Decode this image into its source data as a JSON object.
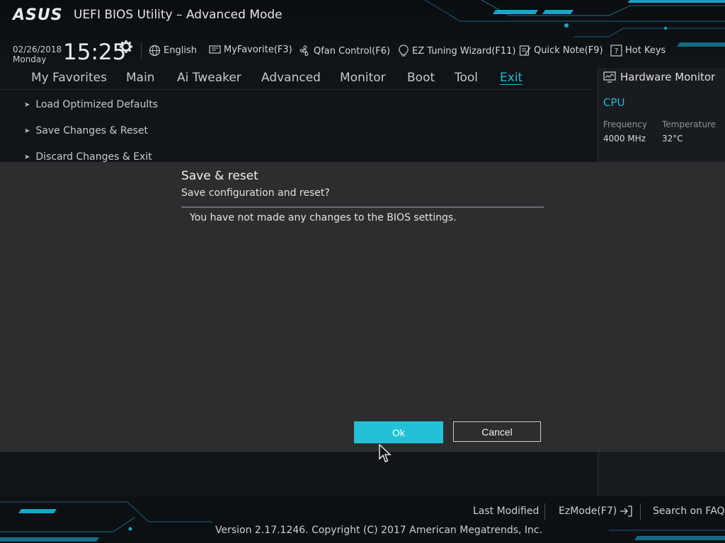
{
  "header": {
    "logo_text": "ASUS",
    "title": "UEFI BIOS Utility – Advanced Mode",
    "date": "02/26/2018",
    "weekday": "Monday",
    "time": "15:25",
    "toolbar": [
      {
        "label": "English",
        "icon": "globe-icon"
      },
      {
        "label": "MyFavorite(F3)",
        "icon": "monitor-icon"
      },
      {
        "label": "Qfan Control(F6)",
        "icon": "fan-icon"
      },
      {
        "label": "EZ Tuning Wizard(F11)",
        "icon": "lightbulb-icon"
      },
      {
        "label": "Quick Note(F9)",
        "icon": "note-icon"
      },
      {
        "label": "Hot Keys",
        "icon": "question-icon"
      }
    ]
  },
  "nav": {
    "tabs": [
      {
        "label": "My Favorites"
      },
      {
        "label": "Main"
      },
      {
        "label": "Ai Tweaker"
      },
      {
        "label": "Advanced"
      },
      {
        "label": "Monitor"
      },
      {
        "label": "Boot"
      },
      {
        "label": "Tool"
      },
      {
        "label": "Exit",
        "active": true
      }
    ]
  },
  "main": {
    "items": [
      {
        "label": "Load Optimized Defaults"
      },
      {
        "label": "Save Changes & Reset"
      },
      {
        "label": "Discard Changes & Exit"
      }
    ]
  },
  "hardware_monitor": {
    "title": "Hardware Monitor",
    "section": "CPU",
    "frequency_label": "Frequency",
    "frequency_value": "4000 MHz",
    "temperature_label": "Temperature",
    "temperature_value": "32°C"
  },
  "dialog": {
    "title": "Save & reset",
    "subtitle": "Save configuration and reset?",
    "message": "You have not made any changes to the BIOS settings.",
    "ok_label": "Ok",
    "cancel_label": "Cancel"
  },
  "footer": {
    "last_modified": "Last Modified",
    "ezmode": "EzMode(F7)",
    "search_faq": "Search on FAQ",
    "copyright": "Version 2.17.1246. Copyright (C) 2017 American Megatrends, Inc."
  },
  "colors": {
    "accent": "#22b7d3",
    "button_ok": "#22c1d8",
    "dialog_bg": "#2c2d2f",
    "background": "#101417"
  }
}
